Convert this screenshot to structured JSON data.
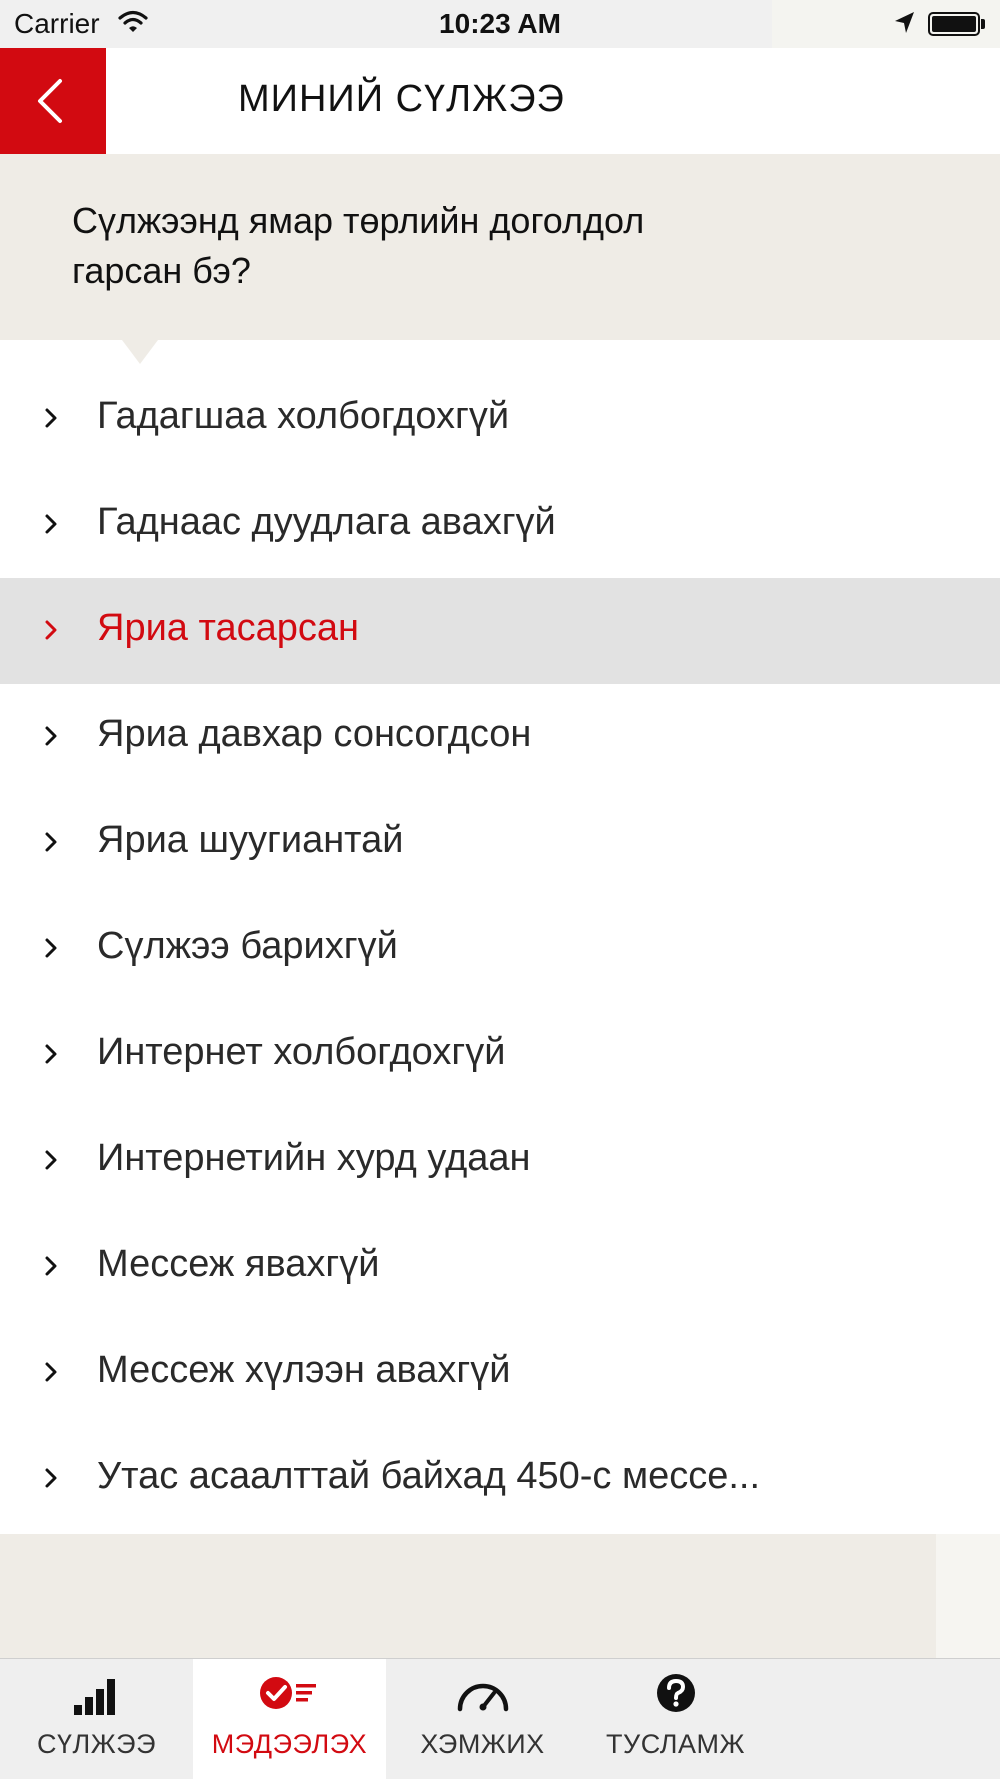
{
  "status_bar": {
    "carrier": "Carrier",
    "time": "10:23 AM",
    "icons": [
      "wifi-icon",
      "location-arrow-icon",
      "battery-icon"
    ]
  },
  "header": {
    "back_icon": "chevron-left-icon",
    "title": "МИНИЙ СҮЛЖЭЭ",
    "accent_color": "#d20a11"
  },
  "question": {
    "text": "Сүлжээнд ямар төрлийн доголдол гарсан бэ?"
  },
  "issues": [
    {
      "label": "Гадагшаа холбогдохгүй",
      "selected": false
    },
    {
      "label": "Гаднаас дуудлага авахгүй",
      "selected": false
    },
    {
      "label": "Яриа тасарсан",
      "selected": true
    },
    {
      "label": "Яриа давхар сонсогдсон",
      "selected": false
    },
    {
      "label": "Яриа шуугиантай",
      "selected": false
    },
    {
      "label": "Сүлжээ барихгүй",
      "selected": false
    },
    {
      "label": "Интернет холбогдохгүй",
      "selected": false
    },
    {
      "label": "Интернетийн хурд удаан",
      "selected": false
    },
    {
      "label": "Мессеж явахгүй",
      "selected": false
    },
    {
      "label": "Мессеж хүлээн авахгүй",
      "selected": false
    },
    {
      "label": "Утас асаалттай байхад 450-с мессе...",
      "selected": false
    }
  ],
  "tabs": [
    {
      "label": "СҮЛЖЭЭ",
      "icon": "signal-bars-icon",
      "active": false
    },
    {
      "label": "МЭДЭЭЛЭХ",
      "icon": "report-check-icon",
      "active": true
    },
    {
      "label": "ХЭМЖИХ",
      "icon": "speedometer-icon",
      "active": false
    },
    {
      "label": "ТУСЛАМЖ",
      "icon": "help-icon",
      "active": false
    }
  ],
  "colors": {
    "accent": "#d20a11",
    "band": "#efece6",
    "selected_row": "#e2e2e2"
  }
}
